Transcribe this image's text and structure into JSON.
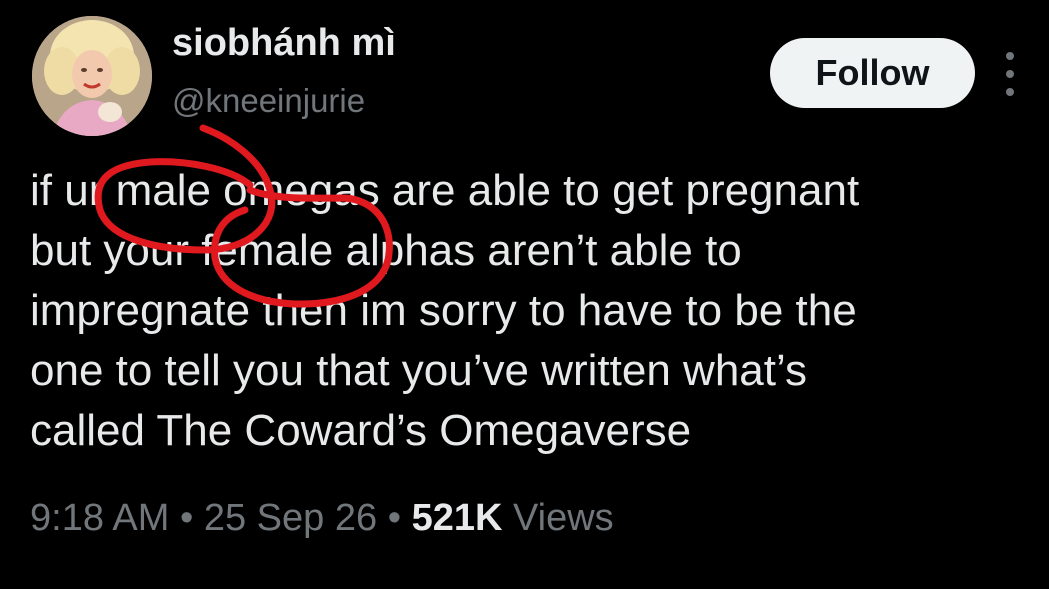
{
  "author": {
    "display_name": "siobhánh mì",
    "handle": "@kneeinjurie",
    "avatar_icon": "profile-photo-avatar"
  },
  "actions": {
    "follow_label": "Follow",
    "more_icon": "more-vertical-icon"
  },
  "tweet": {
    "lines": [
      "if ur male omegas are able to get pregnant",
      "but your female alphas aren’t able to",
      "impregnate then im sorry to have to be the",
      "one to tell you that you’ve written what’s",
      "called The Coward’s Omegaverse"
    ]
  },
  "meta": {
    "time": "9:18 AM",
    "separator": "•",
    "date": "25 Sep 26",
    "views_count": "521K",
    "views_label": "Views"
  },
  "colors": {
    "background": "#000000",
    "primary_text": "#e7e9ea",
    "secondary_text": "#71767b",
    "button_bg": "#eff3f4",
    "annotation_red": "#e0191f"
  }
}
